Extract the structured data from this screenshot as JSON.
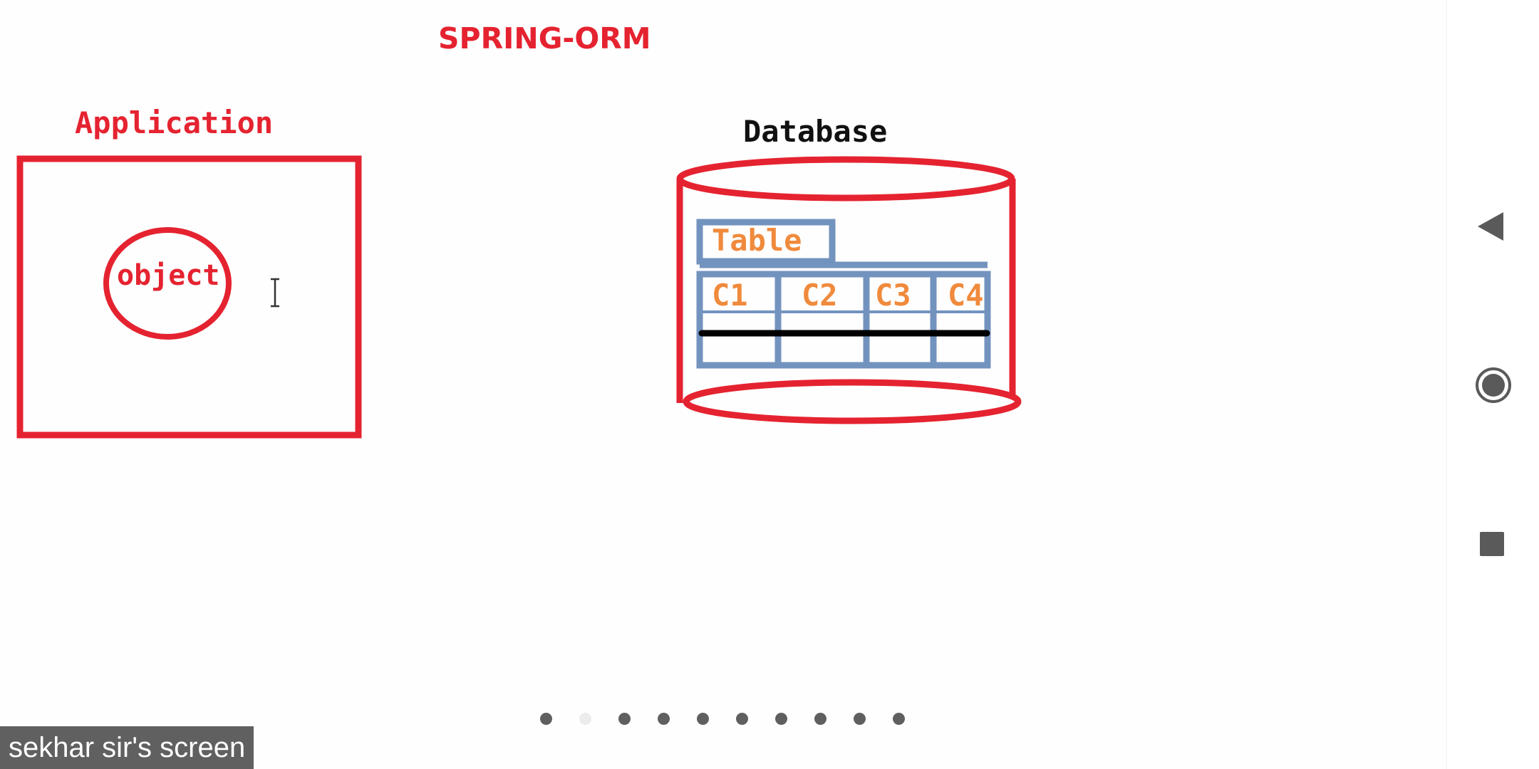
{
  "slide": {
    "title": "SPRING-ORM",
    "application_label": "Application",
    "object_label": "object",
    "database_label": "Database",
    "table_label": "Table",
    "columns": [
      "C1",
      "C2",
      "C3",
      "C4"
    ]
  },
  "pagination": {
    "total": 10,
    "active_index": 1
  },
  "screen_share": {
    "caption": "sekhar sir's screen"
  },
  "navigation": {
    "back_icon": "back-triangle-icon",
    "home_icon": "home-circle-icon",
    "recents_icon": "recents-square-icon"
  },
  "colors": {
    "accent_red": "#e52330",
    "table_orange": "#f08a3c",
    "table_blue": "#7393bf"
  }
}
